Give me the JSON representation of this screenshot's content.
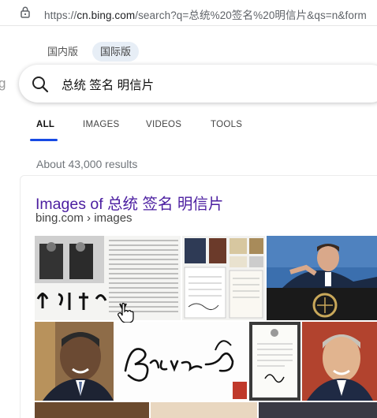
{
  "address_bar": {
    "scheme": "https://",
    "host": "cn.bing.com",
    "rest": "/search?q=总统%20签名%20明信片&qs=n&form"
  },
  "markets": [
    "国内版",
    "国际版"
  ],
  "search": {
    "query": "总统 签名 明信片"
  },
  "scopes": [
    "ALL",
    "IMAGES",
    "VIDEOS",
    "TOOLS"
  ],
  "results_count": "About 43,000 results",
  "result": {
    "title": "Images of 总统 签名 明信片",
    "cite": "bing.com › images"
  },
  "images": [
    {
      "name": "image-korean-signed-document"
    },
    {
      "name": "image-certificate-collage"
    },
    {
      "name": "image-macron-podium"
    },
    {
      "name": "image-obama-portrait"
    },
    {
      "name": "image-signature-closeup"
    },
    {
      "name": "image-signed-letter"
    },
    {
      "name": "image-carter-portrait"
    }
  ],
  "colors": {
    "accent": "#174ae4",
    "visited_link": "#4b1ea0",
    "market_selected_bg": "#e7eef6"
  }
}
